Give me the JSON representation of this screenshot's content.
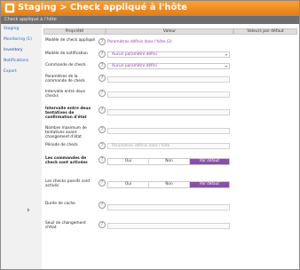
{
  "window": {
    "title": "Staging > Check appliqué à l'hôte",
    "subtitle": "Check appliqué à l'hôte"
  },
  "sidebar": {
    "items": [
      {
        "label": "Staging"
      },
      {
        "label": "Monitoring (1)"
      },
      {
        "label": "Inventory"
      },
      {
        "label": "Notifications"
      },
      {
        "label": "Export"
      }
    ]
  },
  "table": {
    "headers": [
      "Propriété",
      "Valeur",
      "Valeurs par défaut"
    ]
  },
  "rows": [
    {
      "label": "Modèle de check appliqué",
      "value": "Paramètres définis dans l'hôte (2)"
    },
    {
      "label": "Modèle de notification",
      "value": "Aucun paramètre défini"
    },
    {
      "label": "Commande de check",
      "value": "Aucun paramètre défini"
    },
    {
      "label": "Paramètres de la commande de check",
      "value": ""
    },
    {
      "label": "Intervalle entre deux checks",
      "value": ""
    },
    {
      "label": "Intervalle entre deux tentatives de confirmation d'état",
      "value": ""
    },
    {
      "label": "Nombre maximum de tentatives avant changement d'état",
      "value": ""
    },
    {
      "label": "Période de check",
      "value": "Paramètres définis dans l'hôte"
    },
    {
      "label": "Les commandes de check sont activées",
      "options": [
        "Oui",
        "Non",
        "Par défaut"
      ],
      "selected": "Par défaut"
    },
    {
      "label": "Les checks passifs sont activés",
      "options": [
        "Oui",
        "Non",
        "Par défaut"
      ],
      "selected": "Par défaut"
    },
    {
      "label": "Durée de cache",
      "value": ""
    },
    {
      "label": "Seuil de changement d'état",
      "value": ""
    }
  ],
  "colors": {
    "title_bar": "#e57c10",
    "accent": "#8a4ea9",
    "link": "#2a66c8"
  }
}
